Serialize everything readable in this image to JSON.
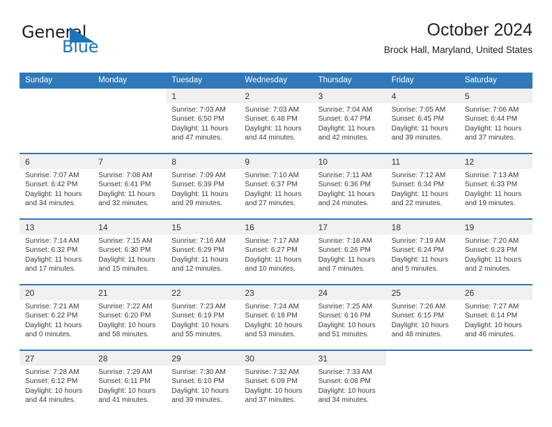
{
  "brand": {
    "name_part1": "General",
    "name_part2": "Blue",
    "mark": "triangle-logo"
  },
  "header": {
    "title": "October 2024",
    "location": "Brock Hall, Maryland, United States"
  },
  "calendar": {
    "weekday_headers": [
      "Sunday",
      "Monday",
      "Tuesday",
      "Wednesday",
      "Thursday",
      "Friday",
      "Saturday"
    ],
    "accent_color": "#3079b8",
    "daynum_band_color": "#f0f0f0",
    "weeks": [
      [
        {
          "day": "",
          "sunrise": "",
          "sunset": "",
          "daylight_line1": "",
          "daylight_line2": ""
        },
        {
          "day": "",
          "sunrise": "",
          "sunset": "",
          "daylight_line1": "",
          "daylight_line2": ""
        },
        {
          "day": "1",
          "sunrise": "Sunrise: 7:03 AM",
          "sunset": "Sunset: 6:50 PM",
          "daylight_line1": "Daylight: 11 hours",
          "daylight_line2": "and 47 minutes."
        },
        {
          "day": "2",
          "sunrise": "Sunrise: 7:03 AM",
          "sunset": "Sunset: 6:48 PM",
          "daylight_line1": "Daylight: 11 hours",
          "daylight_line2": "and 44 minutes."
        },
        {
          "day": "3",
          "sunrise": "Sunrise: 7:04 AM",
          "sunset": "Sunset: 6:47 PM",
          "daylight_line1": "Daylight: 11 hours",
          "daylight_line2": "and 42 minutes."
        },
        {
          "day": "4",
          "sunrise": "Sunrise: 7:05 AM",
          "sunset": "Sunset: 6:45 PM",
          "daylight_line1": "Daylight: 11 hours",
          "daylight_line2": "and 39 minutes."
        },
        {
          "day": "5",
          "sunrise": "Sunrise: 7:06 AM",
          "sunset": "Sunset: 6:44 PM",
          "daylight_line1": "Daylight: 11 hours",
          "daylight_line2": "and 37 minutes."
        }
      ],
      [
        {
          "day": "6",
          "sunrise": "Sunrise: 7:07 AM",
          "sunset": "Sunset: 6:42 PM",
          "daylight_line1": "Daylight: 11 hours",
          "daylight_line2": "and 34 minutes."
        },
        {
          "day": "7",
          "sunrise": "Sunrise: 7:08 AM",
          "sunset": "Sunset: 6:41 PM",
          "daylight_line1": "Daylight: 11 hours",
          "daylight_line2": "and 32 minutes."
        },
        {
          "day": "8",
          "sunrise": "Sunrise: 7:09 AM",
          "sunset": "Sunset: 6:39 PM",
          "daylight_line1": "Daylight: 11 hours",
          "daylight_line2": "and 29 minutes."
        },
        {
          "day": "9",
          "sunrise": "Sunrise: 7:10 AM",
          "sunset": "Sunset: 6:37 PM",
          "daylight_line1": "Daylight: 11 hours",
          "daylight_line2": "and 27 minutes."
        },
        {
          "day": "10",
          "sunrise": "Sunrise: 7:11 AM",
          "sunset": "Sunset: 6:36 PM",
          "daylight_line1": "Daylight: 11 hours",
          "daylight_line2": "and 24 minutes."
        },
        {
          "day": "11",
          "sunrise": "Sunrise: 7:12 AM",
          "sunset": "Sunset: 6:34 PM",
          "daylight_line1": "Daylight: 11 hours",
          "daylight_line2": "and 22 minutes."
        },
        {
          "day": "12",
          "sunrise": "Sunrise: 7:13 AM",
          "sunset": "Sunset: 6:33 PM",
          "daylight_line1": "Daylight: 11 hours",
          "daylight_line2": "and 19 minutes."
        }
      ],
      [
        {
          "day": "13",
          "sunrise": "Sunrise: 7:14 AM",
          "sunset": "Sunset: 6:32 PM",
          "daylight_line1": "Daylight: 11 hours",
          "daylight_line2": "and 17 minutes."
        },
        {
          "day": "14",
          "sunrise": "Sunrise: 7:15 AM",
          "sunset": "Sunset: 6:30 PM",
          "daylight_line1": "Daylight: 11 hours",
          "daylight_line2": "and 15 minutes."
        },
        {
          "day": "15",
          "sunrise": "Sunrise: 7:16 AM",
          "sunset": "Sunset: 6:29 PM",
          "daylight_line1": "Daylight: 11 hours",
          "daylight_line2": "and 12 minutes."
        },
        {
          "day": "16",
          "sunrise": "Sunrise: 7:17 AM",
          "sunset": "Sunset: 6:27 PM",
          "daylight_line1": "Daylight: 11 hours",
          "daylight_line2": "and 10 minutes."
        },
        {
          "day": "17",
          "sunrise": "Sunrise: 7:18 AM",
          "sunset": "Sunset: 6:26 PM",
          "daylight_line1": "Daylight: 11 hours",
          "daylight_line2": "and 7 minutes."
        },
        {
          "day": "18",
          "sunrise": "Sunrise: 7:19 AM",
          "sunset": "Sunset: 6:24 PM",
          "daylight_line1": "Daylight: 11 hours",
          "daylight_line2": "and 5 minutes."
        },
        {
          "day": "19",
          "sunrise": "Sunrise: 7:20 AM",
          "sunset": "Sunset: 6:23 PM",
          "daylight_line1": "Daylight: 11 hours",
          "daylight_line2": "and 2 minutes."
        }
      ],
      [
        {
          "day": "20",
          "sunrise": "Sunrise: 7:21 AM",
          "sunset": "Sunset: 6:22 PM",
          "daylight_line1": "Daylight: 11 hours",
          "daylight_line2": "and 0 minutes."
        },
        {
          "day": "21",
          "sunrise": "Sunrise: 7:22 AM",
          "sunset": "Sunset: 6:20 PM",
          "daylight_line1": "Daylight: 10 hours",
          "daylight_line2": "and 58 minutes."
        },
        {
          "day": "22",
          "sunrise": "Sunrise: 7:23 AM",
          "sunset": "Sunset: 6:19 PM",
          "daylight_line1": "Daylight: 10 hours",
          "daylight_line2": "and 55 minutes."
        },
        {
          "day": "23",
          "sunrise": "Sunrise: 7:24 AM",
          "sunset": "Sunset: 6:18 PM",
          "daylight_line1": "Daylight: 10 hours",
          "daylight_line2": "and 53 minutes."
        },
        {
          "day": "24",
          "sunrise": "Sunrise: 7:25 AM",
          "sunset": "Sunset: 6:16 PM",
          "daylight_line1": "Daylight: 10 hours",
          "daylight_line2": "and 51 minutes."
        },
        {
          "day": "25",
          "sunrise": "Sunrise: 7:26 AM",
          "sunset": "Sunset: 6:15 PM",
          "daylight_line1": "Daylight: 10 hours",
          "daylight_line2": "and 48 minutes."
        },
        {
          "day": "26",
          "sunrise": "Sunrise: 7:27 AM",
          "sunset": "Sunset: 6:14 PM",
          "daylight_line1": "Daylight: 10 hours",
          "daylight_line2": "and 46 minutes."
        }
      ],
      [
        {
          "day": "27",
          "sunrise": "Sunrise: 7:28 AM",
          "sunset": "Sunset: 6:12 PM",
          "daylight_line1": "Daylight: 10 hours",
          "daylight_line2": "and 44 minutes."
        },
        {
          "day": "28",
          "sunrise": "Sunrise: 7:29 AM",
          "sunset": "Sunset: 6:11 PM",
          "daylight_line1": "Daylight: 10 hours",
          "daylight_line2": "and 41 minutes."
        },
        {
          "day": "29",
          "sunrise": "Sunrise: 7:30 AM",
          "sunset": "Sunset: 6:10 PM",
          "daylight_line1": "Daylight: 10 hours",
          "daylight_line2": "and 39 minutes."
        },
        {
          "day": "30",
          "sunrise": "Sunrise: 7:32 AM",
          "sunset": "Sunset: 6:09 PM",
          "daylight_line1": "Daylight: 10 hours",
          "daylight_line2": "and 37 minutes."
        },
        {
          "day": "31",
          "sunrise": "Sunrise: 7:33 AM",
          "sunset": "Sunset: 6:08 PM",
          "daylight_line1": "Daylight: 10 hours",
          "daylight_line2": "and 34 minutes."
        },
        {
          "day": "",
          "sunrise": "",
          "sunset": "",
          "daylight_line1": "",
          "daylight_line2": ""
        },
        {
          "day": "",
          "sunrise": "",
          "sunset": "",
          "daylight_line1": "",
          "daylight_line2": ""
        }
      ]
    ]
  }
}
